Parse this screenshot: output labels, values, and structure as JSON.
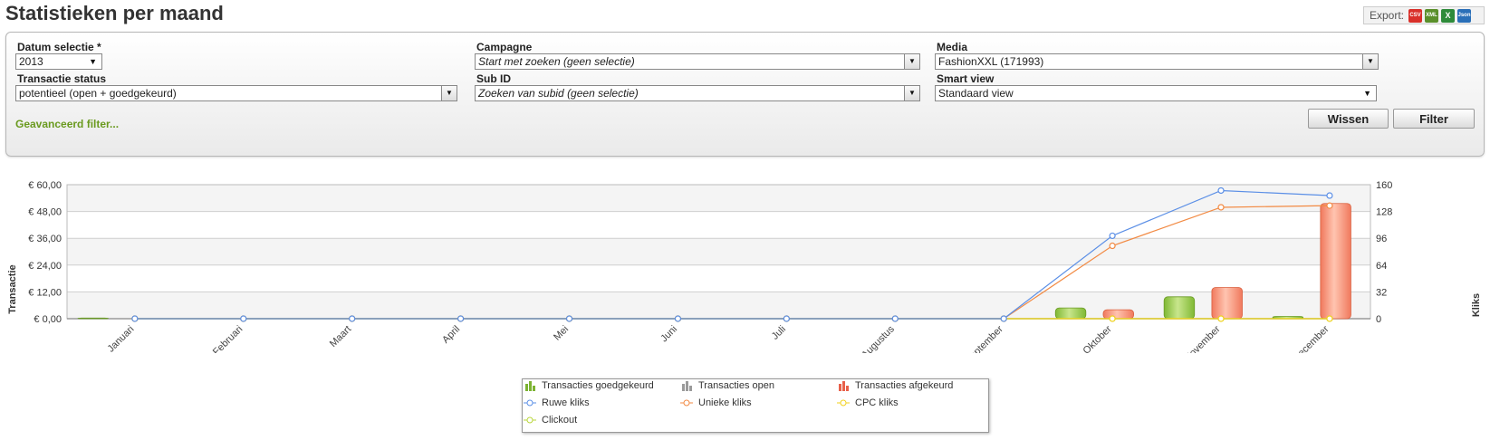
{
  "page": {
    "title": "Statistieken per maand"
  },
  "export": {
    "label": "Export:",
    "icons": [
      {
        "name": "csv-export-icon",
        "text": "CSV",
        "color": "#d9302a"
      },
      {
        "name": "xml-export-icon",
        "text": "XML",
        "color": "#5a8f2a"
      },
      {
        "name": "excel-export-icon",
        "text": "X",
        "color": "#2e8b3a"
      },
      {
        "name": "json-export-icon",
        "text": "Json",
        "color": "#2a6fb8"
      }
    ]
  },
  "filters": {
    "datum": {
      "label": "Datum selectie *",
      "value": "2013"
    },
    "campagne": {
      "label": "Campagne",
      "value": "Start met zoeken (geen selectie)"
    },
    "media": {
      "label": "Media",
      "value": "FashionXXL (171993)"
    },
    "transactie_status": {
      "label": "Transactie status",
      "value": "potentieel (open + goedgekeurd)"
    },
    "sub_id": {
      "label": "Sub ID",
      "value": "Zoeken van subid (geen selectie)"
    },
    "smart_view": {
      "label": "Smart view",
      "value": "Standaard view"
    },
    "advanced_link": "Geavanceerd filter...",
    "clear_button": "Wissen",
    "filter_button": "Filter"
  },
  "chart_data": {
    "type": "bar",
    "categories": [
      "Januari",
      "Februari",
      "Maart",
      "April",
      "Mei",
      "Juni",
      "Juli",
      "Augustus",
      "September",
      "Oktober",
      "November",
      "December"
    ],
    "left_axis": {
      "label": "Transactie",
      "ticks": [
        "€ 0,00",
        "€ 12,00",
        "€ 24,00",
        "€ 36,00",
        "€ 48,00",
        "€ 60,00"
      ],
      "ylim": [
        0,
        60
      ]
    },
    "right_axis": {
      "label": "Kliks",
      "ticks": [
        "0",
        "32",
        "64",
        "96",
        "128",
        "160"
      ],
      "ylim": [
        0,
        160
      ]
    },
    "bar_series": [
      {
        "name": "Transacties goedgekeurd",
        "color": "#8dc63f",
        "values": [
          0.3,
          0,
          0,
          0,
          0,
          0,
          0,
          0,
          0,
          4.8,
          9.8,
          1.0
        ]
      },
      {
        "name": "Transacties open",
        "color": "#9a9a9a",
        "values": [
          0,
          0,
          0,
          0,
          0,
          0,
          0,
          0,
          0,
          0,
          0,
          0
        ]
      },
      {
        "name": "Transacties afgekeurd",
        "color": "#f4836b",
        "values": [
          0,
          0,
          0,
          0,
          0,
          0,
          0,
          0,
          0,
          4.0,
          14.0,
          51.6
        ]
      }
    ],
    "line_series": [
      {
        "name": "Ruwe kliks",
        "color": "#5b8fe6",
        "values": [
          0,
          0,
          0,
          0,
          0,
          0,
          0,
          0,
          0,
          99,
          153,
          147
        ]
      },
      {
        "name": "Unieke kliks",
        "color": "#f28a43",
        "values": [
          0,
          0,
          0,
          0,
          0,
          0,
          0,
          0,
          0,
          87,
          133,
          135
        ]
      },
      {
        "name": "CPC kliks",
        "color": "#f2d21e",
        "values": [
          0,
          0,
          0,
          0,
          0,
          0,
          0,
          0,
          0,
          0,
          0,
          0
        ]
      },
      {
        "name": "Clickout",
        "color": "#b9d63a",
        "values": [
          0,
          0,
          0,
          0,
          0,
          0,
          0,
          0,
          0,
          0,
          0,
          0
        ]
      }
    ],
    "legend": [
      "Transacties goedgekeurd",
      "Transacties open",
      "Transacties afgekeurd",
      "Ruwe kliks",
      "Unieke kliks",
      "CPC kliks",
      "Clickout"
    ]
  }
}
